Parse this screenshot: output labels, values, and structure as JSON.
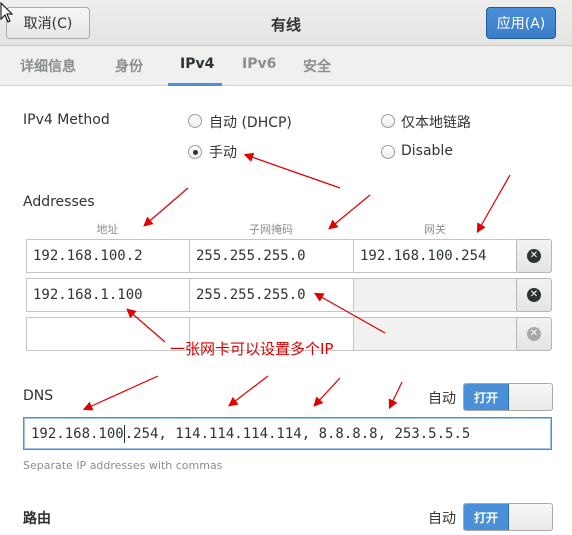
{
  "header": {
    "title": "有线",
    "cancel_label": "取消(C)",
    "apply_label": "应用(A)"
  },
  "tabs": [
    {
      "label": "详细信息",
      "active": false
    },
    {
      "label": "身份",
      "active": false
    },
    {
      "label": "IPv4",
      "active": true
    },
    {
      "label": "IPv6",
      "active": false
    },
    {
      "label": "安全",
      "active": false
    }
  ],
  "method": {
    "label": "IPv4 Method",
    "options": [
      {
        "label": "自动 (DHCP)",
        "checked": false
      },
      {
        "label": "仅本地链路",
        "checked": false
      },
      {
        "label": "手动",
        "checked": true
      },
      {
        "label": "Disable",
        "checked": false
      }
    ]
  },
  "addresses": {
    "label": "Addresses",
    "columns": [
      "地址",
      "子网掩码",
      "网关"
    ],
    "rows": [
      {
        "address": "192.168.100.2",
        "netmask": "255.255.255.0",
        "gateway": "192.168.100.254"
      },
      {
        "address": "192.168.1.100",
        "netmask": "255.255.255.0",
        "gateway": ""
      },
      {
        "address": "",
        "netmask": "",
        "gateway": ""
      }
    ]
  },
  "dns": {
    "label": "DNS",
    "auto_label": "自动",
    "toggle_label": "打开",
    "value_before_caret": "192.168.100",
    "value_after_caret": ".254, 114.114.114.114, 8.8.8.8, 253.5.5.5",
    "hint": "Separate IP addresses with commas"
  },
  "routes": {
    "label": "路由",
    "auto_label": "自动",
    "toggle_label": "打开"
  },
  "annotation": "一张网卡可以设置多个IP",
  "colors": {
    "accent": "#4a90d9",
    "annotation": "#e00000"
  }
}
